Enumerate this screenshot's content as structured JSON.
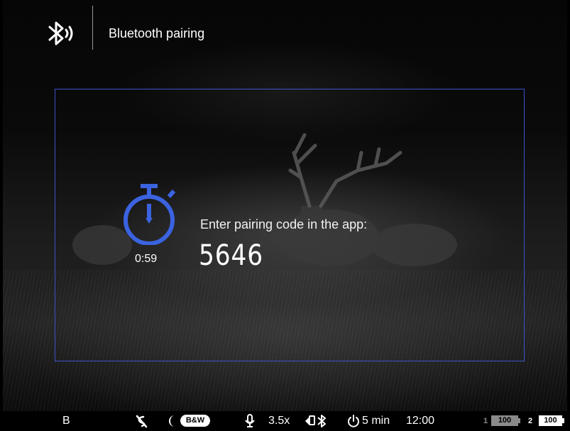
{
  "header": {
    "title": "Bluetooth pairing",
    "icon": "bluetooth-pairing-icon"
  },
  "pairing": {
    "timer": "0:59",
    "prompt": "Enter pairing code in the app:",
    "code": "5646",
    "accent_color": "#3b63e0",
    "frame_color": "#3b55c9"
  },
  "statusbar": {
    "mode": "B",
    "color_mode": "B&W",
    "zoom": "3.5x",
    "auto_off": "5 min",
    "clock": "12:00",
    "battery1_index": "1",
    "battery1_level": "100",
    "battery2_index": "2",
    "battery2_level": "100"
  }
}
